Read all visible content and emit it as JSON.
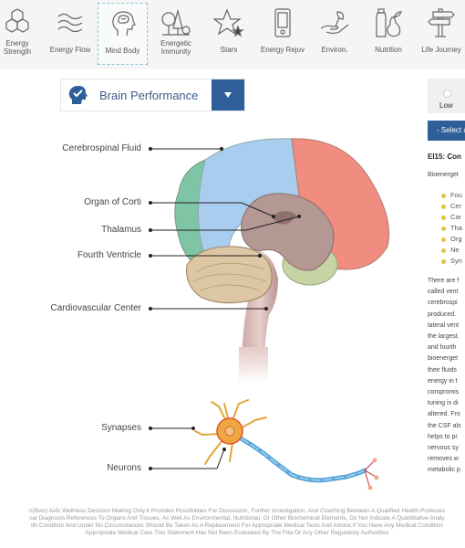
{
  "nav": {
    "items": [
      {
        "label": "Energy Strength",
        "icon": "hexagons-icon"
      },
      {
        "label": "Energy Flow",
        "icon": "waves-icon"
      },
      {
        "label": "Mind Body",
        "icon": "head-brain-icon",
        "active": true
      },
      {
        "label": "Energetic Immunity",
        "icon": "trees-icon"
      },
      {
        "label": "Stars",
        "icon": "star-icon"
      },
      {
        "label": "Energy Rejuv",
        "icon": "phone-icon"
      },
      {
        "label": "Environ.",
        "icon": "hand-plant-icon"
      },
      {
        "label": "Nutrition",
        "icon": "bottle-pear-icon"
      },
      {
        "label": "Life Journey",
        "icon": "signpost-icon"
      }
    ]
  },
  "dropdown": {
    "value": "Brain Performance",
    "icon": "head-check-icon"
  },
  "diagram": {
    "labels": [
      "Cerebrospinal Fluid",
      "Organ of Corti",
      "Thalamus",
      "Fourth Ventricle",
      "Cardiovascular Center",
      "Synapses",
      "Neurons"
    ]
  },
  "right_panel": {
    "level_label": "Low",
    "select_button": "- Select a",
    "title": "EI15: Con",
    "intro": "Bioenerget",
    "bullets": [
      "Fou",
      "Cer",
      "Car",
      "Tha",
      "Org",
      "Ne",
      "Syn"
    ],
    "paragraph_lines": [
      "There are f",
      "called vent",
      "cerebrospi",
      "produced.",
      "lateral vent",
      "the largest.",
      "and fourth",
      "bioenerget",
      "their fluids",
      "energy in t",
      "compromis",
      "tuning is di",
      "altered. Fro",
      "the CSF als",
      "helps to pr",
      "nervous sy",
      "removes w",
      "metabolic p"
    ]
  },
  "footer": {
    "lines": [
      "n(Bws) Aids Wellness Decision Making Only.It Provides Possibilities For Discussion, Further Investigation, And Coaching Between A Qualified Health Professio",
      "cal Diagnosis.References To Organs And Tissues, As Well As Environmental, Nutritional, Or Other Biochemical Elements, Do Not Indicate A Quantitative Analy",
      "lth Condition And Under No Circumstances Should Be Taken As A Replacement For Appropriate Medical Tests And Advice.If You Have Any Medical Condition",
      "Appropriate Medical Care.This Statement Has Not Been Evaluated By The Fda Or Any Other Regulatory Authorities"
    ]
  },
  "colors": {
    "accent": "#2f5f98",
    "bullet": "#e6c23a",
    "active_border": "#7fc6d4"
  }
}
